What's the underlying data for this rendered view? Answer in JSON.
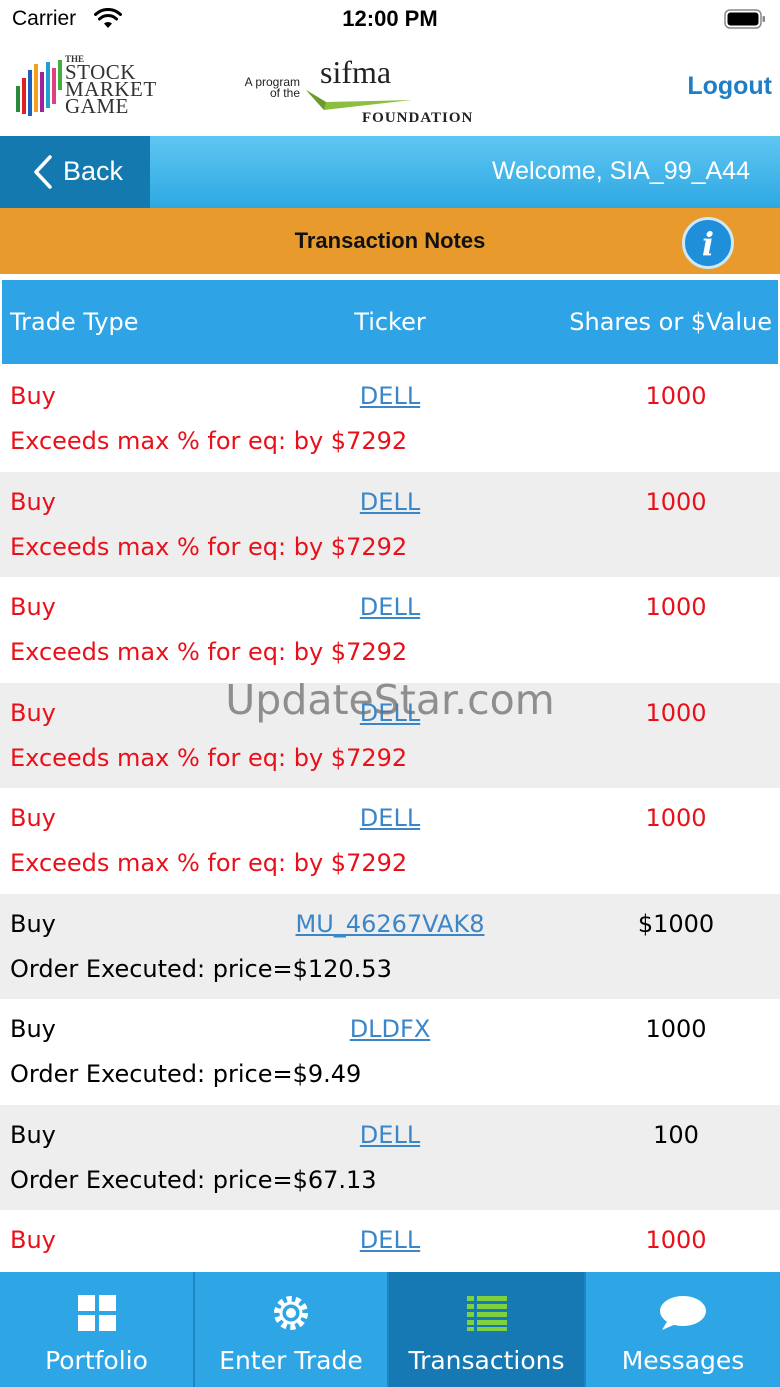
{
  "status_bar": {
    "carrier": "Carrier",
    "time": "12:00 PM"
  },
  "header": {
    "logo_the": "THE",
    "logo_line1": "STOCK",
    "logo_line2": "MARKET",
    "logo_line3": "GAME",
    "program_line1": "A program",
    "program_line2": "of the",
    "sifma": "sifma",
    "foundation": "FOUNDATION",
    "logout_label": "Logout"
  },
  "nav": {
    "back_label": "Back",
    "welcome": "Welcome, SIA_99_A44"
  },
  "title": "Transaction Notes",
  "table": {
    "headers": {
      "type": "Trade Type",
      "ticker": "Ticker",
      "shares": "Shares or $Value"
    },
    "rows": [
      {
        "type": "Buy",
        "ticker": "DELL",
        "shares": "1000",
        "note": "Exceeds max % for eq: by $7292",
        "status": "error"
      },
      {
        "type": "Buy",
        "ticker": "DELL",
        "shares": "1000",
        "note": "Exceeds max % for eq: by $7292",
        "status": "error"
      },
      {
        "type": "Buy",
        "ticker": "DELL",
        "shares": "1000",
        "note": "Exceeds max % for eq: by $7292",
        "status": "error"
      },
      {
        "type": "Buy",
        "ticker": "DELL",
        "shares": "1000",
        "note": "Exceeds max % for eq: by $7292",
        "status": "error"
      },
      {
        "type": "Buy",
        "ticker": "DELL",
        "shares": "1000",
        "note": "Exceeds max % for eq: by $7292",
        "status": "error"
      },
      {
        "type": "Buy",
        "ticker": "MU_46267VAK8",
        "shares": "$1000",
        "note": "Order Executed: price=$120.53",
        "status": "ok"
      },
      {
        "type": "Buy",
        "ticker": "DLDFX",
        "shares": "1000",
        "note": "Order Executed: price=$9.49",
        "status": "ok"
      },
      {
        "type": "Buy",
        "ticker": "DELL",
        "shares": "100",
        "note": "Order Executed: price=$67.13",
        "status": "ok"
      },
      {
        "type": "Buy",
        "ticker": "DELL",
        "shares": "1000",
        "note": "",
        "status": "error"
      }
    ]
  },
  "watermark": "UpdateStar.com",
  "tabs": [
    {
      "label": "Portfolio",
      "icon": "grid-icon"
    },
    {
      "label": "Enter Trade",
      "icon": "gear-icon"
    },
    {
      "label": "Transactions",
      "icon": "list-icon"
    },
    {
      "label": "Messages",
      "icon": "chat-bubble-icon"
    }
  ],
  "active_tab": "Transactions",
  "colors": {
    "accent_blue": "#2ea6e6",
    "active_tab": "#1679b4",
    "title_orange": "#e89b2c",
    "error_red": "#e8101a",
    "link_blue": "#3b86c9",
    "logout_blue": "#1f7fc6"
  }
}
